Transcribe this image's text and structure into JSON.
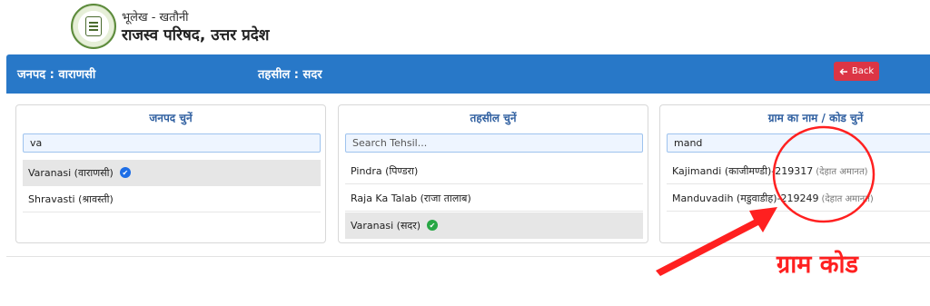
{
  "header": {
    "subtitle": "भूलेख - खतौनी",
    "title": "राजस्व परिषद, उत्तर प्रदेश"
  },
  "bar": {
    "district_label": "जनपद : वाराणसी",
    "tehsil_label": "तहसील : सदर",
    "back_label": "Back",
    "back_icon": "arrow-left-icon",
    "color": "#2878c8",
    "back_color": "#dc3545"
  },
  "district_panel": {
    "title": "जनपद चुनें",
    "search_value": "va",
    "items": [
      {
        "label": "Varanasi (वाराणसी)",
        "selected": true
      },
      {
        "label": "Shravasti (श्रावस्ती)",
        "selected": false
      }
    ]
  },
  "tehsil_panel": {
    "title": "तहसील चुनें",
    "search_placeholder": "Search Tehsil...",
    "items": [
      {
        "label": "Pindra (पिण्डरा)",
        "selected": false
      },
      {
        "label": "Raja Ka Talab (राजा तालाब)",
        "selected": false
      },
      {
        "label": "Varanasi (सदर)",
        "selected": true
      }
    ]
  },
  "village_panel": {
    "title": "ग्राम का नाम / कोड चुनें",
    "search_value": "mand",
    "items": [
      {
        "label": "Kajimandi (काजीमण्डी)-219317",
        "suffix": "(देहात अमानत)"
      },
      {
        "label": "Manduvadih (मडुवाडीह)-219249",
        "suffix": "(देहात अमानत)"
      }
    ]
  },
  "annotation": {
    "text": "ग्राम कोड",
    "color": "#ff2020"
  }
}
